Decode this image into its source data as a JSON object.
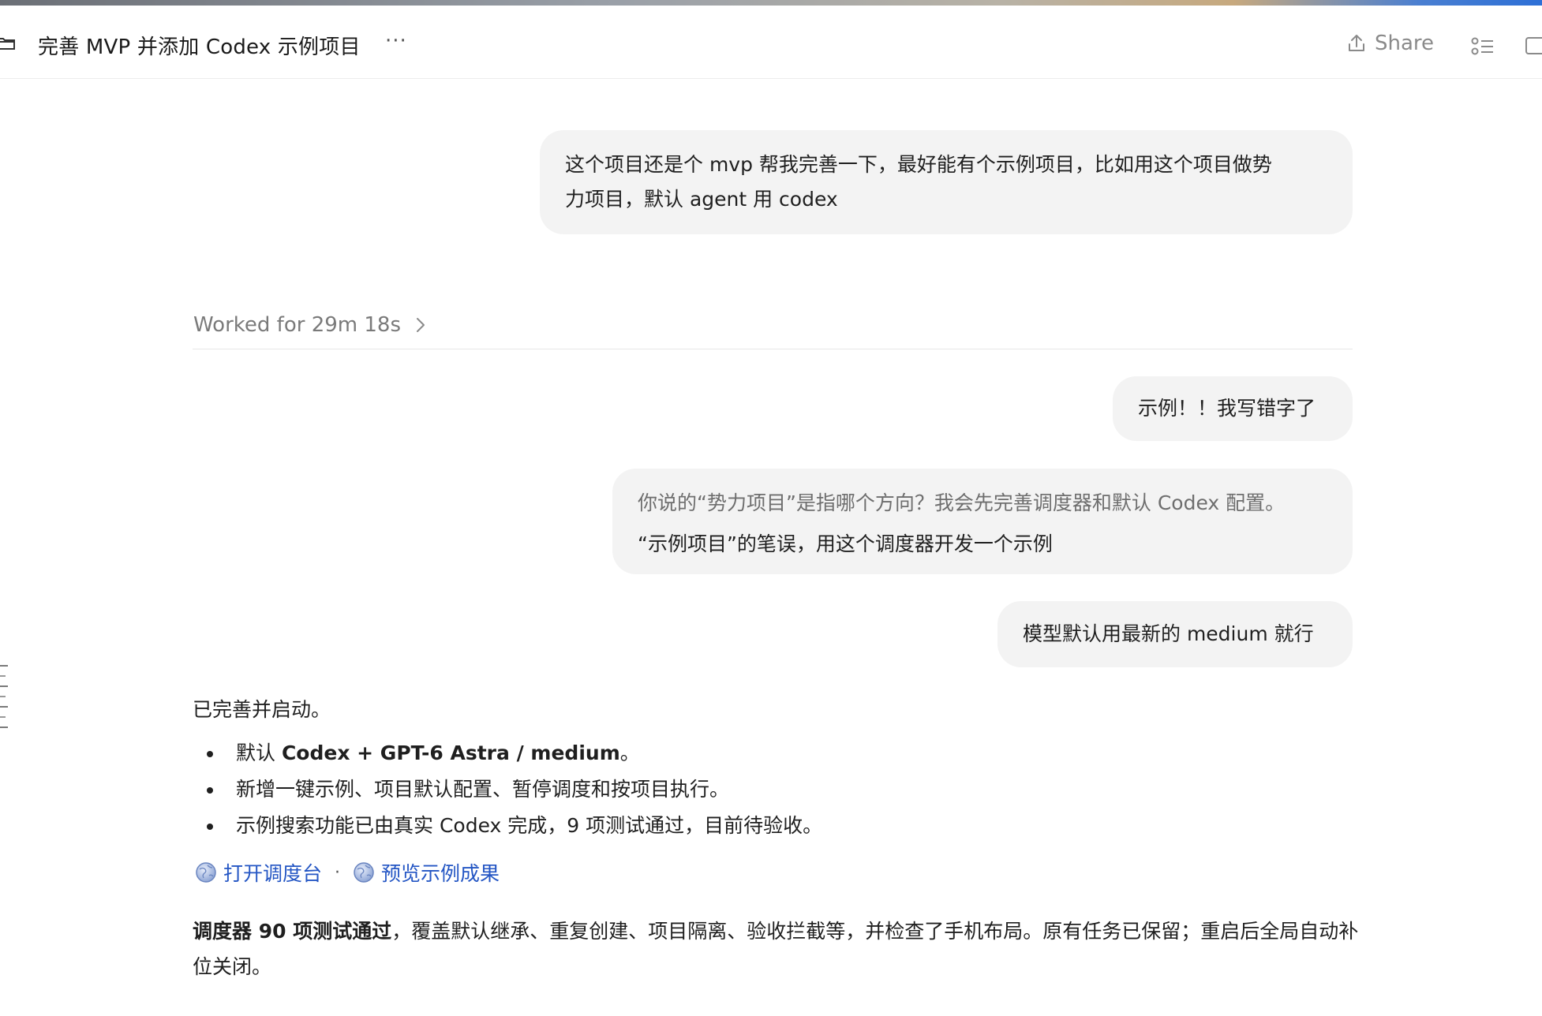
{
  "header": {
    "title": "完善 MVP 并添加 Codex 示例项目",
    "more_label": "···",
    "share_label": "Share"
  },
  "messages": {
    "user_1_line1": "这个项目还是个 mvp 帮我完善一下，最好能有个示例项目，比如用这个项目做势",
    "user_1_line2": "力项目，默认 agent 用 codex",
    "worked_label": "Worked for 29m 18s",
    "user_2": "示例！！我写错字了",
    "question_text": "你说的“势力项目”是指哪个方向？我会先完善调度器和默认 Codex 配置。",
    "answer_text": "“示例项目”的笔误，用这个调度器开发一个示例",
    "user_3": "模型默认用最新的 medium 就行"
  },
  "reply": {
    "intro": "已完善并启动。",
    "bullet_1_prefix": "默认 ",
    "bullet_1_bold": "Codex + GPT-6 Astra / medium",
    "bullet_1_suffix": "。",
    "bullet_2": "新增一键示例、项目默认配置、暂停调度和按项目执行。",
    "bullet_3": "示例搜索功能已由真实 Codex 完成，9 项测试通过，目前待验收。",
    "link_1": "打开调度台",
    "link_sep": "·",
    "link_2": "预览示例成果",
    "summary_bold": "调度器 90 项测试通过",
    "summary_rest": "，覆盖默认继承、重复创建、项目隔离、验收拦截等，并检查了手机布局。原有任务已保留；重启后全局自动补位关闭。"
  },
  "colors": {
    "bubble_bg": "#f3f3f3",
    "link": "#2456c4",
    "muted": "#7a7a7a"
  },
  "icons": [
    "folder-icon",
    "share-icon",
    "list-icon",
    "panel-icon",
    "chevron-right-icon",
    "globe-icon"
  ]
}
